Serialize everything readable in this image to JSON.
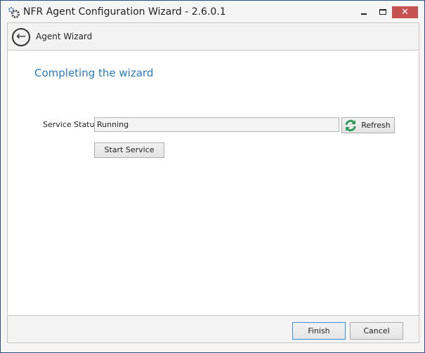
{
  "window": {
    "title": "NFR Agent Configuration Wizard - 2.6.0.1",
    "close": "✕"
  },
  "header": {
    "title": "Agent Wizard"
  },
  "main": {
    "heading": "Completing the wizard",
    "status_label": "Service Status",
    "status_value": "Running",
    "refresh_label": "Refresh",
    "start_label": "Start Service"
  },
  "footer": {
    "finish_label": "Finish",
    "cancel_label": "Cancel"
  },
  "colors": {
    "accent": "#2a7ab8",
    "close": "#c75050",
    "refresh_icon": "#2e9b5e"
  }
}
